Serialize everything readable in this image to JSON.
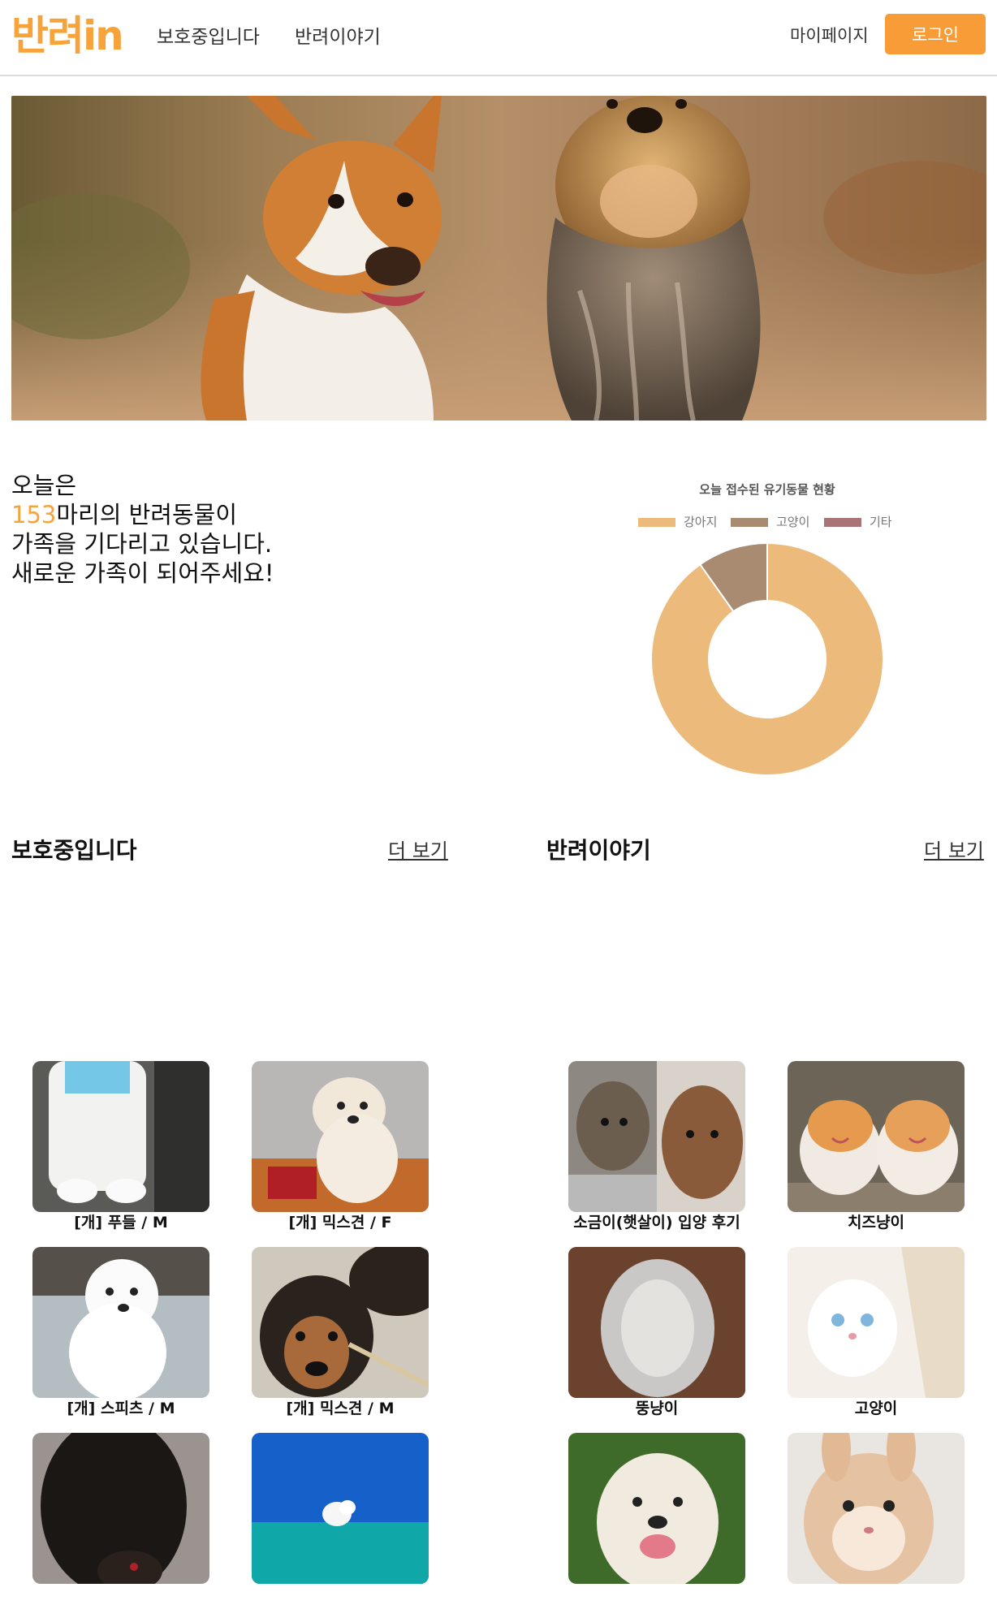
{
  "header": {
    "logo": "반려in",
    "nav": [
      "보호중입니다",
      "반려이야기"
    ],
    "mypage": "마이페이지",
    "login": "로그인"
  },
  "intro": {
    "line1": "오늘은",
    "count": "153",
    "line2_rest": "마리의 반려동물이",
    "line3": "가족을 기다리고 있습니다.",
    "line4": "새로운 가족이 되어주세요!"
  },
  "chart_data": {
    "type": "pie",
    "title": "오늘 접수된 유기동물 현황",
    "categories": [
      "강아지",
      "고양이",
      "기타"
    ],
    "values": [
      138,
      15,
      0
    ],
    "colors": [
      "#ecbb7c",
      "#a98b72",
      "#a97476"
    ],
    "legend_position": "top"
  },
  "protect": {
    "title": "보호중입니다",
    "more": "더 보기",
    "items": [
      {
        "caption": "[개] 푸들 / M"
      },
      {
        "caption": "[개] 믹스견 / F"
      },
      {
        "caption": "[개] 스피츠 / M"
      },
      {
        "caption": "[개] 믹스견 / M"
      },
      {
        "caption": ""
      },
      {
        "caption": ""
      }
    ]
  },
  "story": {
    "title": "반려이야기",
    "more": "더 보기",
    "items": [
      {
        "caption": "소금이(햇살이) 입양 후기"
      },
      {
        "caption": "치즈냥이"
      },
      {
        "caption": "뚱냥이"
      },
      {
        "caption": "고양이"
      },
      {
        "caption": ""
      },
      {
        "caption": ""
      }
    ]
  }
}
